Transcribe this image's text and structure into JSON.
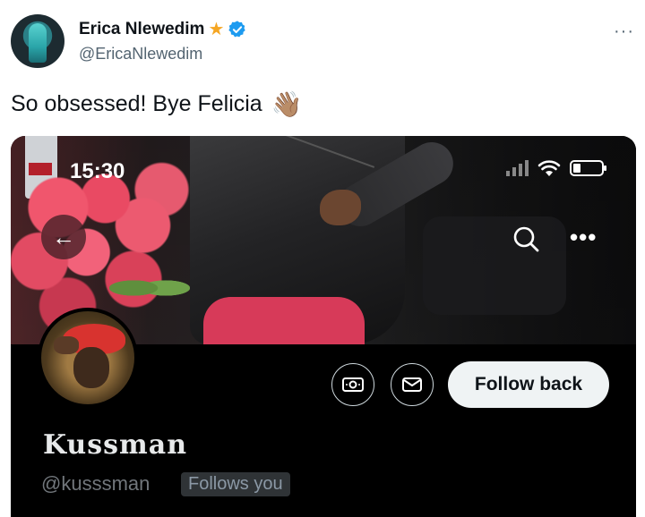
{
  "tweet": {
    "author_name": "Erica Nlewedim",
    "author_badge": "★",
    "author_handle": "@EricaNlewedim",
    "more_label": "···",
    "text": "So obsessed! Bye Felicia",
    "emoji": "👋🏽"
  },
  "screenshot": {
    "status_time": "15:30",
    "back_label": "←",
    "more_label": "•••",
    "profile": {
      "name": "Kussman",
      "handle": "@kusssman",
      "follows_badge": "Follows you",
      "follow_button": "Follow back"
    }
  },
  "colors": {
    "verified": "#1d9bf0",
    "star": "#f5a623",
    "follow_button_bg": "#eff3f4"
  },
  "icons": {
    "verified": "verified-icon",
    "star": "star-icon",
    "wave": "waving-hand-icon",
    "search": "search-icon",
    "money": "money-icon",
    "message": "envelope-icon",
    "wifi": "wifi-icon",
    "battery": "battery-icon"
  }
}
